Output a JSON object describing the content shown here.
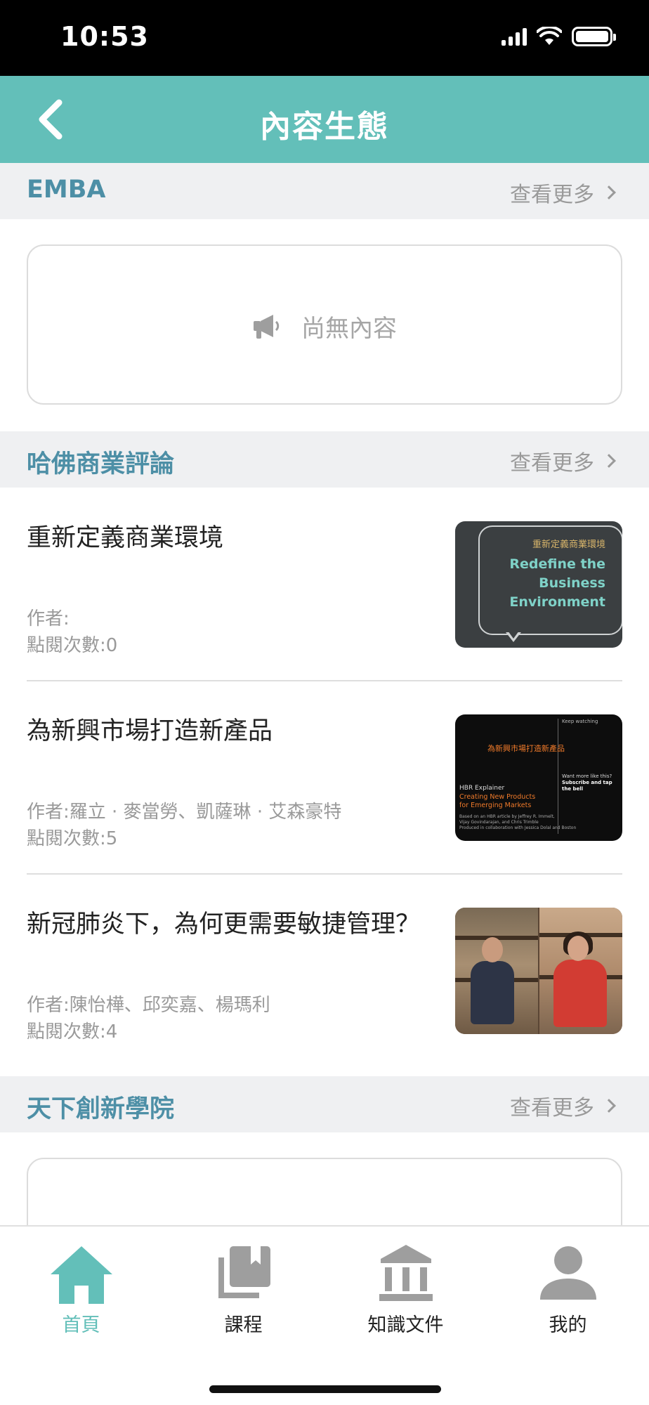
{
  "status_bar": {
    "time": "10:53"
  },
  "header": {
    "title": "內容生態",
    "back_icon": "chevron-left-icon"
  },
  "colors": {
    "accent": "#63bfb9",
    "section_title": "#4d8fa6",
    "muted": "#9a9a9a",
    "section_bg": "#eff0f2"
  },
  "sections": [
    {
      "title": "EMBA",
      "see_more": "查看更多",
      "empty_text": "尚無內容",
      "empty_icon": "megaphone-icon"
    },
    {
      "title": "哈佛商業評論",
      "see_more": "查看更多"
    },
    {
      "title": "天下創新學院",
      "see_more": "查看更多"
    }
  ],
  "articles": [
    {
      "title": "重新定義商業環境",
      "author": "作者:",
      "views": "點閱次數:0",
      "thumb": {
        "zh": "重新定義商業環境",
        "en1": "Redefine the",
        "en2": "Business",
        "en3": "Environment"
      }
    },
    {
      "title": "為新興市場打造新產品",
      "author": "作者:羅立 · 麥當勞、凱薩琳 · 艾森豪特",
      "views": "點閱次數:5",
      "thumb": {
        "zh": "為新興市場打造新產品",
        "line1": "HBR Explainer",
        "line2": "Creating New Products",
        "line3": "for Emerging Markets",
        "line4": "Based on an HBR article by Jeffrey R. Immelt,",
        "line5": "Vijay Govindarajan, and Chris Trimble",
        "line6": "Produced in collaboration with Jessica Dolal and Boston",
        "side1": "Keep watching",
        "side2": "Want more like this?",
        "side3": "Subscribe and tap the bell"
      }
    },
    {
      "title": "新冠肺炎下，為何更需要敏捷管理？",
      "author": "作者:陳怡樺、邱奕嘉、楊瑪利",
      "views": "點閱次數:4"
    }
  ],
  "tabs": [
    {
      "label": "首頁",
      "icon": "home-icon",
      "active": true
    },
    {
      "label": "課程",
      "icon": "library-books-icon",
      "active": false
    },
    {
      "label": "知識文件",
      "icon": "institution-icon",
      "active": false
    },
    {
      "label": "我的",
      "icon": "person-icon",
      "active": false
    }
  ]
}
